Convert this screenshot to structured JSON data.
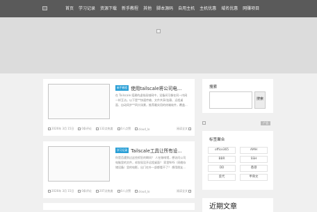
{
  "nav": [
    "首页",
    "学习记录",
    "资源下载",
    "新手教程",
    "其他",
    "脚本源码",
    "自用主机",
    "主机优惠",
    "域名优惠",
    "网赚项目"
  ],
  "posts": [
    {
      "tag": "新手教程",
      "title": "使用tailscale将公司电...",
      "excerpt": "在 Tailscale 搭建的虚拟局域网中，设备间可像在同一内网一样互访。以下是**快速传输、文件共享/挂载、远程桌面、自动同步**四大场景，推荐最实用的终端软件，覆盖...",
      "date": "2026年 3月 15日",
      "comments": "0条评论",
      "views": "132点热度",
      "likes": "0人点赞",
      "author": "cloud_lo",
      "more": "阅读全文"
    },
    {
      "tag": "学习记录",
      "title": "Tailscale工具让所有设...",
      "excerpt": "你是否遇到过这些抓狂的瞬间？ 人在咖啡馆，想访问公司电脑里的文件，却发现没开远程桌面？ 家里NAS（网络存储设备）里的电影，出门在外一部都看不了？ 想用朋友...",
      "date": "2026年 3月 15日",
      "comments": "0条评论",
      "views": "207点热度",
      "likes": "0人点赞",
      "author": "cloud_lo",
      "more": "阅读全文"
    }
  ],
  "sidebar": {
    "search_title": "搜索",
    "search_button": "搜索",
    "ad_label": "广告",
    "tags_title": "标签聚合",
    "tags": [
      "office365",
      "AMH",
      "BBR",
      "SSH",
      "DD",
      "香港",
      "反代",
      "甲骨文"
    ],
    "recent_title": "近期文章"
  }
}
